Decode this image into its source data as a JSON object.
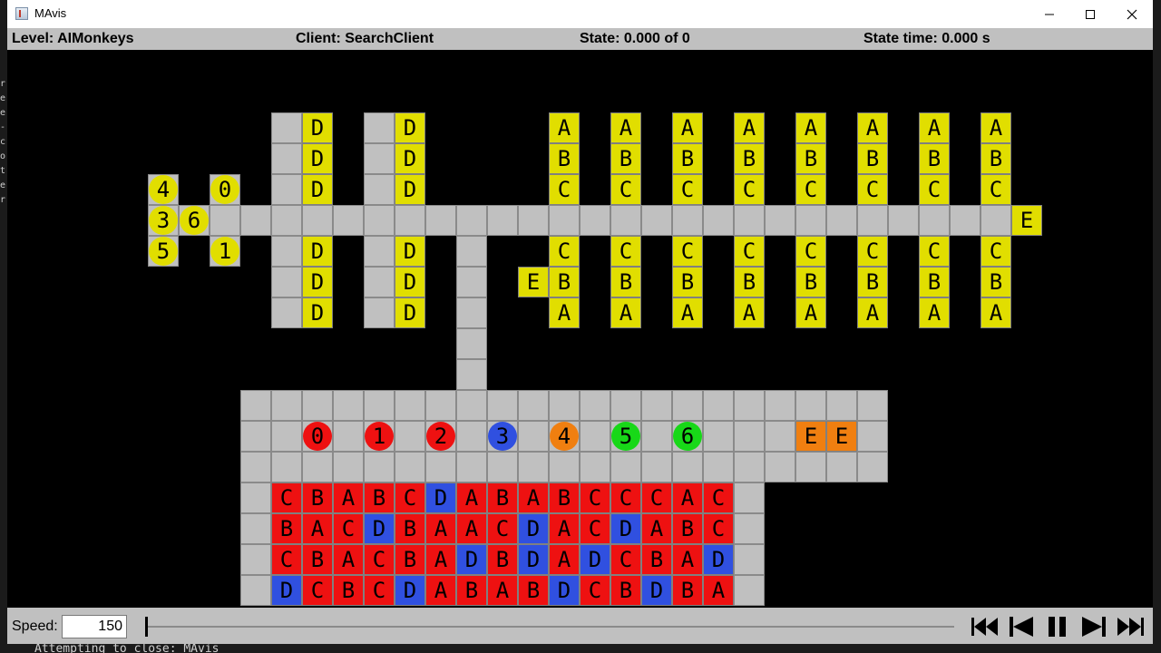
{
  "window": {
    "title": "MAvis",
    "minimize_label": "—",
    "maximize_label": "☐",
    "close_label": "✕"
  },
  "status": {
    "level": "Level: AIMonkeys",
    "client": "Client: SearchClient",
    "state": "State: 0.000 of 0",
    "state_time": "State time: 0.000 s"
  },
  "colors": {
    "yellow": "#e1de00",
    "red": "#ee1111",
    "blue": "#3050e0",
    "orange": "#f07f10",
    "green": "#18d818",
    "floor": "#c0c0c0"
  },
  "level": {
    "yellow_boxes": [
      {
        "col": 5,
        "row": 1,
        "label": "D"
      },
      {
        "col": 5,
        "row": 2,
        "label": "D"
      },
      {
        "col": 5,
        "row": 3,
        "label": "D"
      },
      {
        "col": 5,
        "row": 5,
        "label": "D"
      },
      {
        "col": 5,
        "row": 6,
        "label": "D"
      },
      {
        "col": 5,
        "row": 7,
        "label": "D"
      },
      {
        "col": 8,
        "row": 1,
        "label": "D"
      },
      {
        "col": 8,
        "row": 2,
        "label": "D"
      },
      {
        "col": 8,
        "row": 3,
        "label": "D"
      },
      {
        "col": 8,
        "row": 5,
        "label": "D"
      },
      {
        "col": 8,
        "row": 6,
        "label": "D"
      },
      {
        "col": 8,
        "row": 7,
        "label": "D"
      },
      {
        "col": 12,
        "row": 6,
        "label": "E"
      },
      {
        "col": 28,
        "row": 4,
        "label": "E"
      },
      {
        "col": 13,
        "row": 1,
        "label": "A"
      },
      {
        "col": 13,
        "row": 2,
        "label": "B"
      },
      {
        "col": 13,
        "row": 3,
        "label": "C"
      },
      {
        "col": 13,
        "row": 5,
        "label": "C"
      },
      {
        "col": 13,
        "row": 6,
        "label": "B"
      },
      {
        "col": 13,
        "row": 7,
        "label": "A"
      },
      {
        "col": 15,
        "row": 1,
        "label": "A"
      },
      {
        "col": 15,
        "row": 2,
        "label": "B"
      },
      {
        "col": 15,
        "row": 3,
        "label": "C"
      },
      {
        "col": 15,
        "row": 5,
        "label": "C"
      },
      {
        "col": 15,
        "row": 6,
        "label": "B"
      },
      {
        "col": 15,
        "row": 7,
        "label": "A"
      },
      {
        "col": 17,
        "row": 1,
        "label": "A"
      },
      {
        "col": 17,
        "row": 2,
        "label": "B"
      },
      {
        "col": 17,
        "row": 3,
        "label": "C"
      },
      {
        "col": 17,
        "row": 5,
        "label": "C"
      },
      {
        "col": 17,
        "row": 6,
        "label": "B"
      },
      {
        "col": 17,
        "row": 7,
        "label": "A"
      },
      {
        "col": 19,
        "row": 1,
        "label": "A"
      },
      {
        "col": 19,
        "row": 2,
        "label": "B"
      },
      {
        "col": 19,
        "row": 3,
        "label": "C"
      },
      {
        "col": 19,
        "row": 5,
        "label": "C"
      },
      {
        "col": 19,
        "row": 6,
        "label": "B"
      },
      {
        "col": 19,
        "row": 7,
        "label": "A"
      },
      {
        "col": 21,
        "row": 1,
        "label": "A"
      },
      {
        "col": 21,
        "row": 2,
        "label": "B"
      },
      {
        "col": 21,
        "row": 3,
        "label": "C"
      },
      {
        "col": 21,
        "row": 5,
        "label": "C"
      },
      {
        "col": 21,
        "row": 6,
        "label": "B"
      },
      {
        "col": 21,
        "row": 7,
        "label": "A"
      },
      {
        "col": 23,
        "row": 1,
        "label": "A"
      },
      {
        "col": 23,
        "row": 2,
        "label": "B"
      },
      {
        "col": 23,
        "row": 3,
        "label": "C"
      },
      {
        "col": 23,
        "row": 5,
        "label": "C"
      },
      {
        "col": 23,
        "row": 6,
        "label": "B"
      },
      {
        "col": 23,
        "row": 7,
        "label": "A"
      },
      {
        "col": 25,
        "row": 1,
        "label": "A"
      },
      {
        "col": 25,
        "row": 2,
        "label": "B"
      },
      {
        "col": 25,
        "row": 3,
        "label": "C"
      },
      {
        "col": 25,
        "row": 5,
        "label": "C"
      },
      {
        "col": 25,
        "row": 6,
        "label": "B"
      },
      {
        "col": 25,
        "row": 7,
        "label": "A"
      },
      {
        "col": 27,
        "row": 1,
        "label": "A"
      },
      {
        "col": 27,
        "row": 2,
        "label": "B"
      },
      {
        "col": 27,
        "row": 3,
        "label": "C"
      },
      {
        "col": 27,
        "row": 5,
        "label": "C"
      },
      {
        "col": 27,
        "row": 6,
        "label": "B"
      },
      {
        "col": 27,
        "row": 7,
        "label": "A"
      }
    ],
    "yellow_agents": [
      {
        "col": 0,
        "row": 3,
        "label": "4"
      },
      {
        "col": 2,
        "row": 3,
        "label": "0"
      },
      {
        "col": 0,
        "row": 4,
        "label": "3"
      },
      {
        "col": 1,
        "row": 4,
        "label": "6"
      },
      {
        "col": 0,
        "row": 5,
        "label": "5"
      },
      {
        "col": 2,
        "row": 5,
        "label": "1"
      }
    ],
    "room_agents": [
      {
        "col": 5,
        "row": 11,
        "label": "0",
        "color": "red"
      },
      {
        "col": 7,
        "row": 11,
        "label": "1",
        "color": "red"
      },
      {
        "col": 9,
        "row": 11,
        "label": "2",
        "color": "red"
      },
      {
        "col": 11,
        "row": 11,
        "label": "3",
        "color": "blue"
      },
      {
        "col": 13,
        "row": 11,
        "label": "4",
        "color": "orange"
      },
      {
        "col": 15,
        "row": 11,
        "label": "5",
        "color": "green"
      },
      {
        "col": 17,
        "row": 11,
        "label": "6",
        "color": "green"
      }
    ],
    "orange_boxes": [
      {
        "col": 21,
        "row": 11,
        "label": "E"
      },
      {
        "col": 22,
        "row": 11,
        "label": "E"
      }
    ],
    "box_grid": [
      [
        "C",
        "B",
        "A",
        "B",
        "C",
        "D",
        "A",
        "B",
        "A",
        "B",
        "C",
        "C",
        "C",
        "A",
        "C"
      ],
      [
        "B",
        "A",
        "C",
        "D",
        "B",
        "A",
        "A",
        "C",
        "D",
        "A",
        "C",
        "D",
        "A",
        "B",
        "C"
      ],
      [
        "C",
        "B",
        "A",
        "C",
        "B",
        "A",
        "D",
        "B",
        "D",
        "A",
        "D",
        "C",
        "B",
        "A",
        "D"
      ],
      [
        "D",
        "C",
        "B",
        "C",
        "D",
        "A",
        "B",
        "A",
        "B",
        "D",
        "C",
        "B",
        "D",
        "B",
        "A"
      ]
    ]
  },
  "controls": {
    "speed_label": "Speed:",
    "speed_value": "150",
    "timeline_position": 0
  },
  "background_text": {
    "bottom_console": "Attempting to close: MAvis",
    "left_fragments": [
      "r",
      "e",
      "e",
      "-",
      "c",
      "o",
      "t",
      "e",
      "r"
    ]
  }
}
